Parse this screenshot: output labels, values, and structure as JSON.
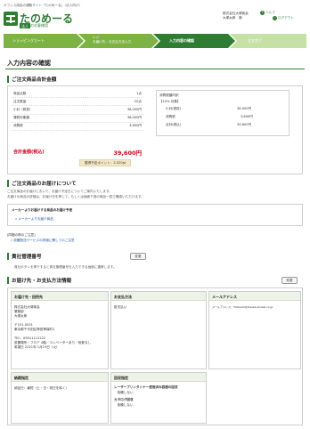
{
  "site": {
    "tagline": "オフィス用品の通販サイト「たのめーる」（法人向け）",
    "logo_main": "たのめーる",
    "logo_sub": "法人",
    "logo_sub2": "のお客様用",
    "company": "株式会社大塚商会",
    "user": "大塚太郎　様",
    "help_label": "ヘルプ",
    "logout_label": "ログアウト"
  },
  "steps": [
    {
      "label": "ショッピングカート"
    },
    {
      "label": "レジ\nお届け先・お支払方法入力"
    },
    {
      "label": "入力内容の確認"
    },
    {
      "label": "注文完了"
    }
  ],
  "page_title": "入力内容の確認",
  "summary": {
    "title": "ご注文商品合計金額",
    "rows": [
      {
        "label": "商品点数",
        "value": "1点"
      },
      {
        "label": "注文数量",
        "value": "20点"
      },
      {
        "label": "小計（税抜）",
        "value": "36,000円"
      },
      {
        "label": "課税対象額",
        "value": "36,000円"
      },
      {
        "label": "消費税",
        "value": "3,600円"
      }
    ],
    "total_label": "合計金額(税込)",
    "total_value": "39,600円",
    "points": "獲得予定ポイント：2,520pt",
    "tax_box": {
      "title": "消費税額内訳",
      "subtitle": "【10% 対象】",
      "rows": [
        {
          "label": "小計(税抜)",
          "value": "36,000円"
        },
        {
          "label": "消費税",
          "value": "3,600円"
        },
        {
          "label": "合計(税込)",
          "value": "39,600円"
        }
      ]
    }
  },
  "delivery_info": {
    "title": "ご注文商品のお届けについて",
    "line1": "ご注文商品のお届けにおいて、お届け予定日についてご案内いたします。",
    "line2": "お届けの商品の詳細は、お届け日を押して、もしくは画面下部の商品一覧で確認いただけます。",
    "maker_label": "メーカーよりお届けする商品のお届け予定",
    "maker_link": "» メーカーよりお届け商品",
    "note_title": "[同梱の際のご注意]",
    "note_link": "» 設置配送サービスの詳細に関してのご注意"
  },
  "mgmt": {
    "title": "貴社管理番号",
    "change": "変更",
    "text": "貴社ボタンを押下すると貴社管理番号を入力できる画面に遷移します。"
  },
  "ship": {
    "title": "お届け先・お支払方法情報",
    "change": "変更",
    "dest_title": "お届け先・田所先",
    "dest_lines": [
      "株式会社大塚商会",
      "業務部",
      "大塚太郎",
      "",
      "〒101-0051",
      "東京都千代田区神田神保町1",
      "",
      "TEL：09011112222",
      "設置場所：フロア 4階／エレベーターあり／段差なし",
      "希望日 2021年 1月19日（火）"
    ],
    "pay_title": "お支払方法",
    "pay_value": "掛支払い",
    "mail_title": "メールアドレス",
    "mail_value": "メールアドレス：T.Kitsuki@otsuka-shokai.co.jp",
    "date_title": "納期指定",
    "date_value": "納品日：最短（土・日・祝日を除く）",
    "collect_title": "回収指定",
    "collect_l1": "レーザープリンタトナー使用済み容器の回収",
    "collect_l2": "　依頼しない",
    "collect_l3": "カタログ回収",
    "collect_l4": "　依頼しない"
  }
}
